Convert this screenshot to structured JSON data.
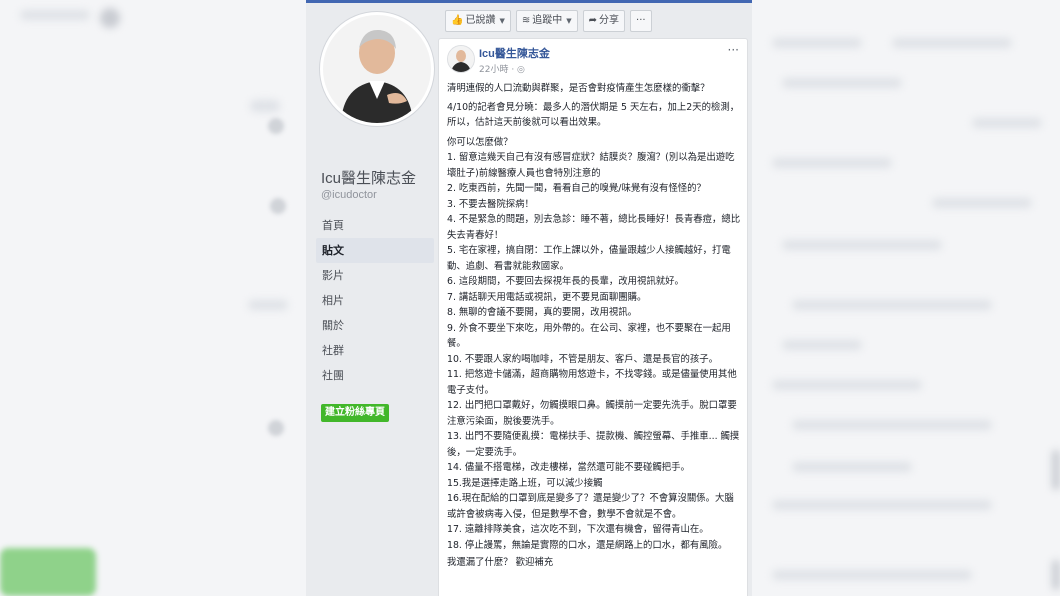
{
  "toolbar": {
    "liked": "已說讚",
    "following": "追蹤中",
    "share": "分享",
    "more": "···"
  },
  "page": {
    "name": "Icu醫生陳志金",
    "handle": "@icudoctor"
  },
  "nav": {
    "items": [
      "首頁",
      "貼文",
      "影片",
      "相片",
      "關於",
      "社群",
      "社團"
    ],
    "active_index": 1,
    "create_page": "建立粉絲專頁"
  },
  "post": {
    "author": "Icu醫生陳志金",
    "time": "22小時 · ",
    "more": "···",
    "intro": "清明連假的人口流動與群聚，是否會對疫情產生怎麼樣的衝擊？",
    "presser": "4/10的記者會見分曉：最多人的潛伏期是 5 天左右，加上2天的檢測，所以，估計這天前後就可以看出效果。",
    "question": "你可以怎麼做？",
    "items": [
      "1. 留意這幾天自己有沒有感冒症狀？結膜炎？腹瀉？(別以為是出遊吃壞肚子)前線醫療人員也會特別注意的",
      "2. 吃東西前，先聞一聞，看看自己的嗅覺/味覺有沒有怪怪的？",
      "3. 不要去醫院探病！",
      "4. 不是緊急的問題，別去急診：睡不著，總比長睡好！長青春痘，總比失去青春好！",
      "5. 宅在家裡，搞自閉：工作上課以外，儘量跟越少人接觸越好，打電動、追劇、看書就能救國家。",
      "6. 這段期間，不要回去探視年長的長輩，改用視訊就好。",
      "7. 講話聊天用電話或視訊，更不要見面聊團購。",
      "8. 無聊的會議不要開，真的要開，改用視訊。",
      "9. 外食不要坐下來吃，用外帶的。在公司、家裡，也不要聚在一起用餐。",
      "10. 不要跟人家約喝咖啡，不管是朋友、客戶、還是長官的孩子。",
      "11. 把悠遊卡儲滿，超商購物用悠遊卡，不找零錢。或是儘量使用其他電子支付。",
      "12. 出門把口罩戴好，勿觸摸眼口鼻。觸摸前一定要先洗手。脫口罩要注意污染面，脫後要洗手。",
      "13. 出門不要隨便亂摸：電梯扶手、提款機、觸控螢幕、手推車... 觸摸後，一定要洗手。",
      "14. 儘量不搭電梯，改走樓梯，當然還可能不要碰觸把手。",
      "15.我是選擇走路上班，可以減少接觸",
      "16.現在配給的口罩到底是變多了？還是變少了？不會算沒關係。大腦或許會被病毒入侵，但是數學不會，數學不會就是不會。",
      "17. 遠離排隊美食，這次吃不到，下次還有機會，留得青山在。",
      "18. 停止謾罵，無論是實際的口水，還是網路上的口水，都有風險。"
    ],
    "closing": "我還漏了什麼？ 歡迎補充"
  },
  "colors": {
    "brand_blue": "#4267b2",
    "link_blue": "#365899",
    "green_button": "#42b72a",
    "frame_gray": "#e9ebee"
  }
}
